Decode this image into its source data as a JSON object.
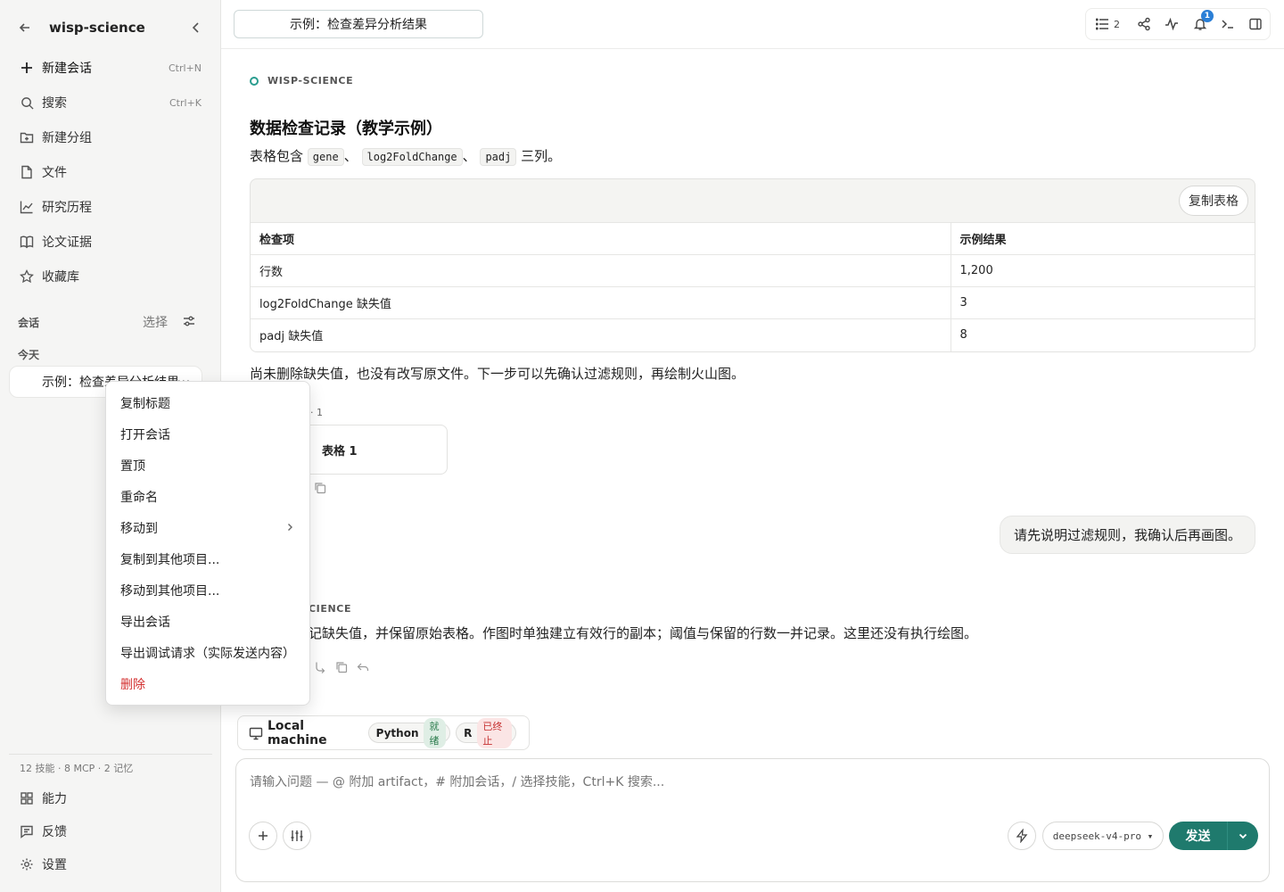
{
  "sidebar": {
    "title": "wisp-science",
    "nav": [
      {
        "label": "新建会话",
        "shortcut": "Ctrl+N",
        "icon": "plus-icon"
      },
      {
        "label": "搜索",
        "shortcut": "Ctrl+K",
        "icon": "search-icon"
      },
      {
        "label": "新建分组",
        "shortcut": "",
        "icon": "folder-plus-icon"
      },
      {
        "label": "文件",
        "shortcut": "",
        "icon": "file-icon"
      },
      {
        "label": "研究历程",
        "shortcut": "",
        "icon": "chart-line-icon"
      },
      {
        "label": "论文证据",
        "shortcut": "",
        "icon": "book-icon"
      },
      {
        "label": "收藏库",
        "shortcut": "",
        "icon": "star-icon"
      }
    ],
    "section_label": "会话",
    "select_label": "选择",
    "today_label": "今天",
    "conversation_item": "示例：检查差异分析结果",
    "conversation_more": "···",
    "stats": "12 技能 · 8 MCP · 2 记忆",
    "footer": [
      {
        "label": "能力",
        "icon": "grid-icon"
      },
      {
        "label": "反馈",
        "icon": "message-icon"
      },
      {
        "label": "设置",
        "icon": "gear-icon"
      }
    ]
  },
  "topbar": {
    "tab_title": "示例：检查差异分析结果",
    "list_count": "2",
    "notification_count": "1"
  },
  "message1": {
    "brand": "WISP-SCIENCE",
    "heading": "数据检查记录（教学示例）",
    "intro_prefix": "表格包含",
    "col1": "gene",
    "sep1": "、",
    "col2": "log2FoldChange",
    "sep2": "、",
    "col3": "padj",
    "intro_suffix": "三列。",
    "copy_table": "复制表格",
    "table_headers": [
      "检查项",
      "示例结果"
    ],
    "table_rows": [
      [
        "行数",
        "1,200"
      ],
      [
        "log2FoldChange 缺失值",
        "3"
      ],
      [
        "padj 缺失值",
        "8"
      ]
    ],
    "summary": "尚未删除缺失值，也没有改写原文件。下一步可以先确认过滤规则，再绘制火山图。",
    "artifact_label": "· 1",
    "artifact_card": "表格 1"
  },
  "user_message": "请先说明过滤规则，我确认后再画图。",
  "message2": {
    "brand": "CIENCE",
    "text": "记缺失值，并保留原始表格。作图时单独建立有效行的副本；阈值与保留的行数一并记录。这里还没有执行绘图。"
  },
  "runtime": {
    "machine": "Local machine",
    "python_label": "Python",
    "python_status": "就绪",
    "r_label": "R",
    "r_status": "已终止"
  },
  "composer": {
    "placeholder": "请输入问题 — @ 附加 artifact，# 附加会话，/ 选择技能，Ctrl+K 搜索...",
    "model": "deepseek-v4-pro ▾",
    "send": "发送"
  },
  "context_menu": {
    "items": [
      {
        "label": "复制标题"
      },
      {
        "label": "打开会话"
      },
      {
        "label": "置顶"
      },
      {
        "label": "重命名"
      },
      {
        "label": "移动到"
      },
      {
        "label": "复制到其他项目..."
      },
      {
        "label": "移动到其他项目..."
      },
      {
        "label": "导出会话"
      },
      {
        "label": "导出调试请求（实际发送内容）"
      },
      {
        "label": "删除"
      }
    ]
  },
  "colors": {
    "accent": "#1f7a6d",
    "danger": "#d32f2f",
    "badge": "#2b7fd6"
  }
}
